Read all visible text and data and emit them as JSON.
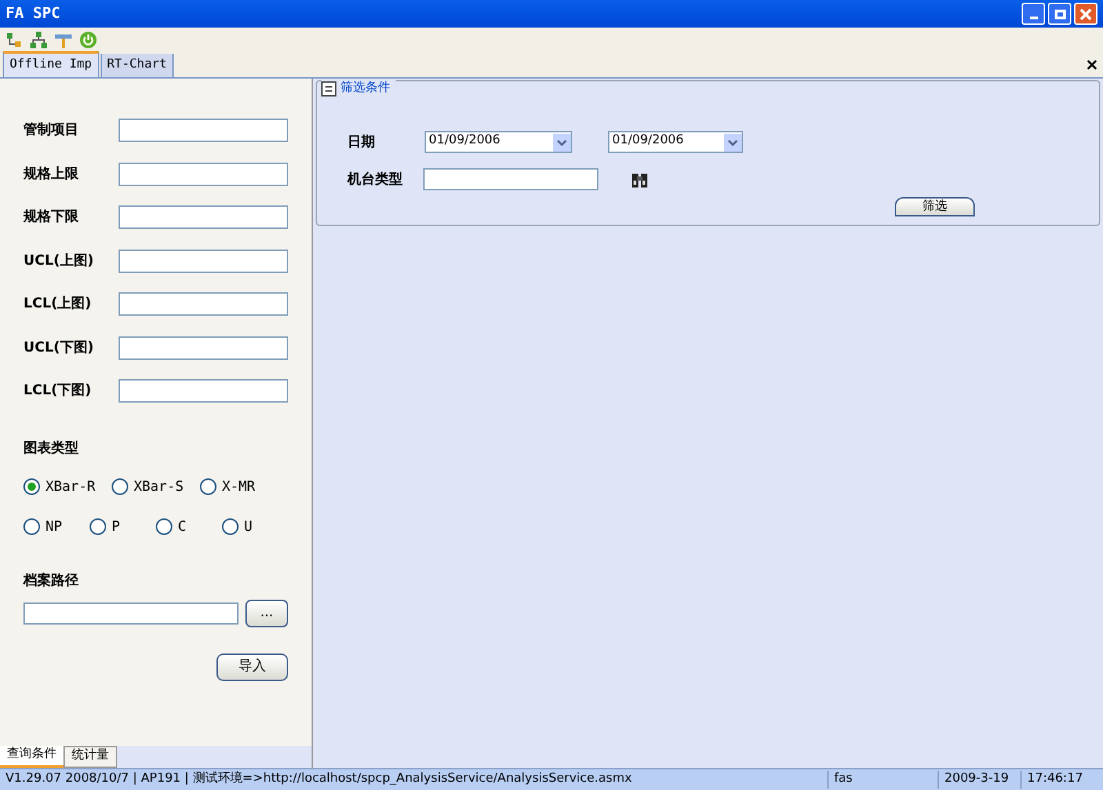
{
  "window": {
    "title": "FA SPC"
  },
  "tabs": [
    {
      "label": "Offline Imp",
      "selected": true
    },
    {
      "label": "RT-Chart",
      "selected": false
    }
  ],
  "form": {
    "fields": [
      {
        "label": "管制项目"
      },
      {
        "label": "规格上限"
      },
      {
        "label": "规格下限"
      },
      {
        "label": "UCL(上图)"
      },
      {
        "label": "LCL(上图)"
      },
      {
        "label": "UCL(下图)"
      },
      {
        "label": "LCL(下图)"
      }
    ],
    "chart_type_label": "图表类型",
    "chart_types": [
      [
        {
          "label": "XBar-R",
          "selected": true
        },
        {
          "label": "XBar-S",
          "selected": false
        },
        {
          "label": "X-MR",
          "selected": false
        }
      ],
      [
        {
          "label": "NP",
          "selected": false
        },
        {
          "label": "P",
          "selected": false
        },
        {
          "label": "C",
          "selected": false
        },
        {
          "label": "U",
          "selected": false
        }
      ]
    ],
    "path_label": "档案路径",
    "browse_button": "...",
    "import_button": "导入"
  },
  "bottom_tabs": [
    {
      "label": "查询条件",
      "selected": true
    },
    {
      "label": "统计量",
      "selected": false
    }
  ],
  "filter": {
    "title": "筛选条件",
    "date_label": "日期",
    "date_from": "01/09/2006",
    "date_to": "01/09/2006",
    "machine_label": "机台类型",
    "filter_button": "筛选"
  },
  "status_bar": [
    "V1.29.07  2008/10/7  |  AP191  | 测试环境=>http://localhost/spcp_AnalysisService/AnalysisService.asmx",
    "fas",
    "2009-3-19",
    "17:46:17"
  ]
}
